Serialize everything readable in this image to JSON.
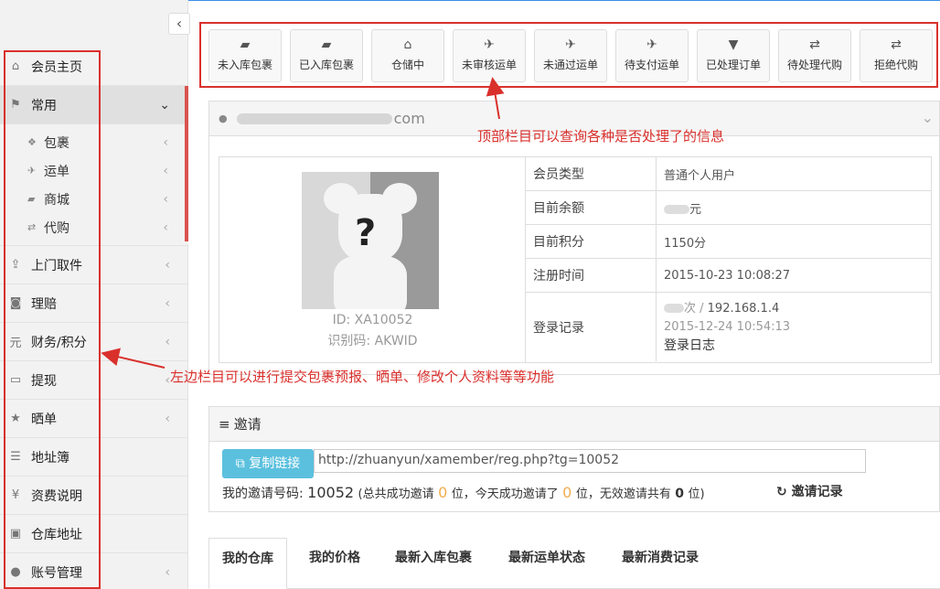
{
  "sidebar": {
    "collapse_icon": "chevron-left-icon",
    "items": [
      {
        "label": "会员主页",
        "icon": "home-icon",
        "glyph": "⌂",
        "chevron": ""
      },
      {
        "label": "常用",
        "icon": "flag-icon",
        "glyph": "⚑",
        "chevron": "⌄"
      },
      {
        "label": "上门取件",
        "icon": "upload-icon",
        "glyph": "⇪",
        "chevron": "‹"
      },
      {
        "label": "理赔",
        "icon": "money-icon",
        "glyph": "◙",
        "chevron": "‹"
      },
      {
        "label": "财务/积分",
        "icon": "yuan-icon",
        "glyph": "元",
        "chevron": "‹"
      },
      {
        "label": "提现",
        "icon": "credit-card-icon",
        "glyph": "▭",
        "chevron": "‹"
      },
      {
        "label": "晒单",
        "icon": "star-icon",
        "glyph": "★",
        "chevron": "‹"
      },
      {
        "label": "地址簿",
        "icon": "address-book-icon",
        "glyph": "☰",
        "chevron": ""
      },
      {
        "label": "资费说明",
        "icon": "yen-icon",
        "glyph": "¥",
        "chevron": ""
      },
      {
        "label": "仓库地址",
        "icon": "archive-icon",
        "glyph": "▣",
        "chevron": ""
      },
      {
        "label": "账号管理",
        "icon": "user-icon",
        "glyph": "●",
        "chevron": "‹"
      }
    ],
    "sub_items": [
      {
        "label": "包裹",
        "icon": "dropbox-icon",
        "glyph": "❖"
      },
      {
        "label": "运单",
        "icon": "plane-icon",
        "glyph": "✈"
      },
      {
        "label": "商城",
        "icon": "cart-icon",
        "glyph": "▰"
      },
      {
        "label": "代购",
        "icon": "retweet-icon",
        "glyph": "⇄"
      }
    ]
  },
  "top_buttons": [
    {
      "label": "未入库包裹",
      "icon": "truck-icon",
      "glyph": "▰"
    },
    {
      "label": "已入库包裹",
      "icon": "truck-icon",
      "glyph": "▰"
    },
    {
      "label": "仓储中",
      "icon": "inbox-icon",
      "glyph": "⌂"
    },
    {
      "label": "未审核运单",
      "icon": "plane-icon",
      "glyph": "✈"
    },
    {
      "label": "未通过运单",
      "icon": "plane-icon",
      "glyph": "✈"
    },
    {
      "label": "待支付运单",
      "icon": "plane-icon",
      "glyph": "✈"
    },
    {
      "label": "已处理订单",
      "icon": "cart-icon",
      "glyph": "▼"
    },
    {
      "label": "待处理代购",
      "icon": "retweet-icon",
      "glyph": "⇄"
    },
    {
      "label": "拒绝代购",
      "icon": "retweet-icon",
      "glyph": "⇄"
    }
  ],
  "user_panel": {
    "email_suffix": "com",
    "id_line": "ID: XA10052",
    "code_line": "识别码: AKWID",
    "rows": [
      {
        "key": "会员类型",
        "value": "普通个人用户"
      },
      {
        "key": "目前余额",
        "value": "元"
      },
      {
        "key": "目前积分",
        "value": "1150分"
      },
      {
        "key": "注册时间",
        "value": "2015-10-23 10:08:27"
      }
    ],
    "login": {
      "key": "登录记录",
      "count_suffix": "次 /",
      "ip": "192.168.1.4",
      "time": "2015-12-24 10:54:13",
      "log_link": "登录日志"
    }
  },
  "invite": {
    "title": "邀请",
    "copy_label": "复制链接",
    "url": "http://zhuanyun/xamember/reg.php?tg=10052",
    "code_label": "我的邀请号码:",
    "code": "10052",
    "stats_1": "(总共成功邀请",
    "total": "0",
    "stats_2": "位，今天成功邀请了",
    "today": "0",
    "stats_3": "位，无效邀请共有",
    "invalid": "0",
    "stats_4": "位)",
    "records_label": "邀请记录"
  },
  "tabs": [
    "我的仓库",
    "我的价格",
    "最新入库包裹",
    "最新运单状态",
    "最新消费记录"
  ],
  "annotations": {
    "top": "顶部栏目可以查询各种是否处理了的信息",
    "left": "左边栏目可以进行提交包裹预报、晒单、修改个人资料等等功能"
  },
  "colors": {
    "annotation": "#d9302c",
    "copy_button": "#5bc0de",
    "highlight": "#f0ad4e"
  }
}
